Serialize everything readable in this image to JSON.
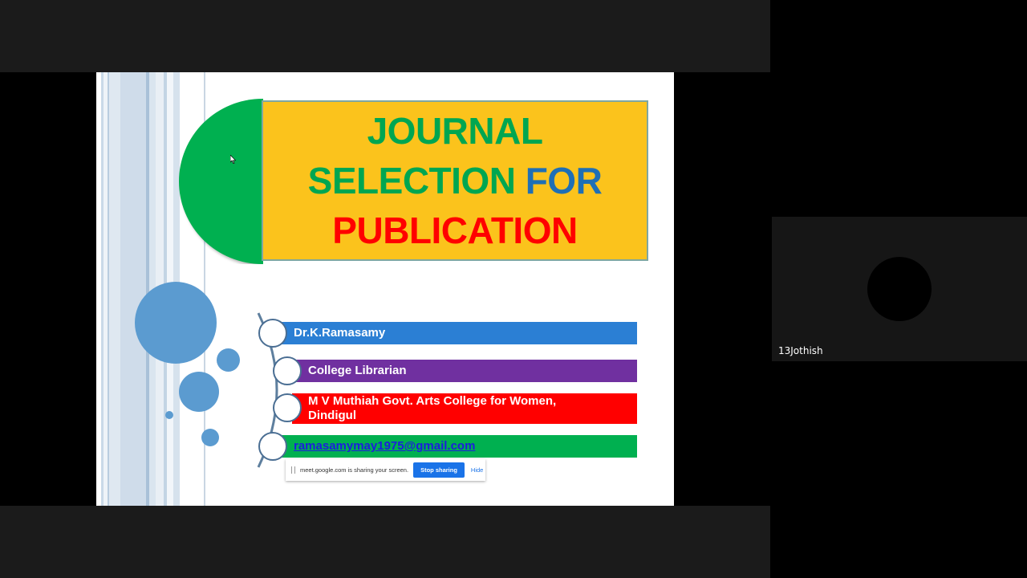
{
  "slide": {
    "title": {
      "line1": "JOURNAL",
      "line2_part1": "SELECTION ",
      "line2_part2": "FOR",
      "line3": "PUBLICATION"
    },
    "details": [
      {
        "text": "Dr.K.Ramasamy",
        "color": "#2b7fd4"
      },
      {
        "text": "College Librarian",
        "color": "#7030a0"
      },
      {
        "text": "M V Muthiah Govt. Arts College for Women, Dindigul",
        "color": "#ff0000"
      },
      {
        "text": "ramasamymay1975@gmail.com",
        "color": "#00b050"
      }
    ],
    "colors": {
      "title_box": "#fbc31c",
      "half_disc": "#00b050",
      "title_green": "#00a651",
      "title_blue": "#1f6fb5",
      "title_red": "#ff0000",
      "bubbles": "#5b9bd0"
    }
  },
  "share_banner": {
    "message": "meet.google.com is sharing your screen.",
    "stop_label": "Stop sharing",
    "hide_label": "Hide"
  },
  "participant": {
    "name": "13Jothish"
  }
}
